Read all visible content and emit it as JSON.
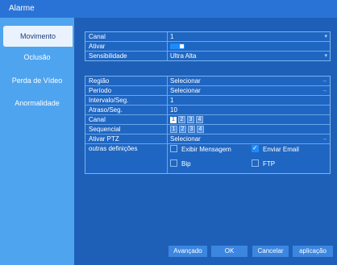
{
  "window": {
    "title": "Alarme"
  },
  "sidebar": {
    "items": [
      {
        "label": "Movimento"
      },
      {
        "label": "Oclusão"
      },
      {
        "label": "Perda de Vídeo"
      },
      {
        "label": "Anormalidade"
      }
    ]
  },
  "top": {
    "canal": {
      "label": "Canal",
      "value": "1"
    },
    "ativar": {
      "label": "Ativar",
      "enabled": true
    },
    "sensibilidade": {
      "label": "Sensibilidade",
      "value": "Ultra Alta"
    }
  },
  "config": {
    "regiao": {
      "label": "Região",
      "value": "Selecionar"
    },
    "periodo": {
      "label": "Período",
      "value": "Selecionar"
    },
    "intervalo": {
      "label": "Intervalo/Seg.",
      "value": "1"
    },
    "atraso": {
      "label": "Atraso/Seg.",
      "value": "10"
    },
    "canal": {
      "label": "Canal",
      "channels": [
        {
          "n": "1",
          "on": true
        },
        {
          "n": "2",
          "on": false
        },
        {
          "n": "3",
          "on": false
        },
        {
          "n": "4",
          "on": false
        }
      ]
    },
    "sequencial": {
      "label": "Sequencial",
      "channels": [
        {
          "n": "1",
          "on": false
        },
        {
          "n": "2",
          "on": false
        },
        {
          "n": "3",
          "on": false
        },
        {
          "n": "4",
          "on": false
        }
      ]
    },
    "ptz": {
      "label": "Ativar PTZ",
      "value": "Selecionar"
    },
    "outras": {
      "label": "outras definições",
      "options": {
        "exibir": {
          "label": "Exibir Mensagem",
          "checked": false
        },
        "email": {
          "label": "Enviar Email",
          "checked": true
        },
        "bip": {
          "label": "Bip",
          "checked": false
        },
        "ftp": {
          "label": "FTP",
          "checked": false
        }
      }
    }
  },
  "buttons": {
    "avancado": "Avançado",
    "ok": "OK",
    "cancelar": "Cancelar",
    "aplicacao": "aplicação"
  },
  "colors": {
    "titlebar": "#2a73d6",
    "sidebar": "#4fa4ef",
    "panel": "#1e60b8",
    "accent": "#1a8cff"
  }
}
